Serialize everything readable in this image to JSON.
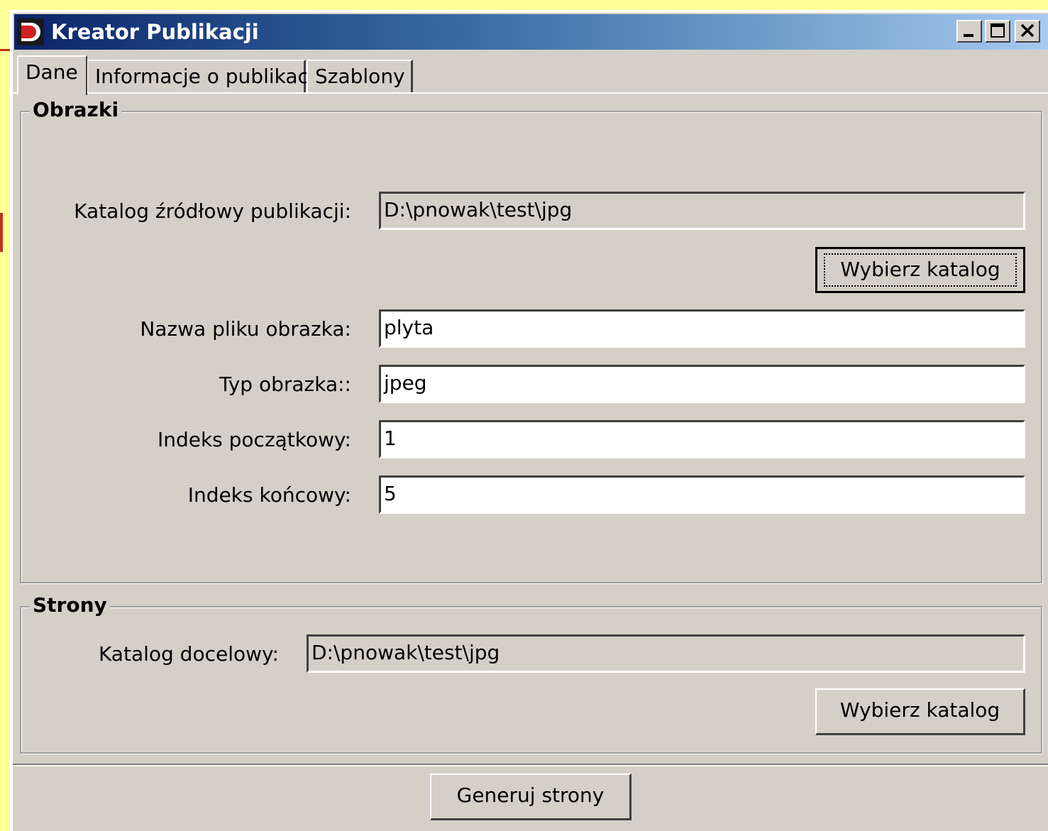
{
  "window": {
    "title": "Kreator Publikacji",
    "title_bar_gradient": [
      "#0a246a",
      "#a6caf0"
    ],
    "controls": {
      "minimize": "minimize-icon",
      "maximize": "maximize-icon",
      "close": "close-icon"
    }
  },
  "tabs": [
    {
      "label": "Dane",
      "active": true
    },
    {
      "label": "Informacje o publikacji",
      "active": false
    },
    {
      "label": "Szablony",
      "active": false
    }
  ],
  "obrazki": {
    "title": "Obrazki",
    "source_dir_label": "Katalog źródłowy publikacji:",
    "source_dir_value": "D:\\pnowak\\test\\jpg",
    "choose_dir_button": "Wybierz katalog",
    "filename_label": "Nazwa pliku obrazka:",
    "filename_value": "plyta",
    "type_label": "Typ obrazka::",
    "type_value": "jpeg",
    "start_index_label": "Indeks początkowy:",
    "start_index_value": "1",
    "end_index_label": "Indeks końcowy:",
    "end_index_value": "5"
  },
  "strony": {
    "title": "Strony",
    "target_dir_label": "Katalog docelowy:",
    "target_dir_value": "D:\\pnowak\\test\\jpg",
    "choose_dir_button": "Wybierz katalog"
  },
  "footer": {
    "generate_button": "Generuj strony"
  }
}
